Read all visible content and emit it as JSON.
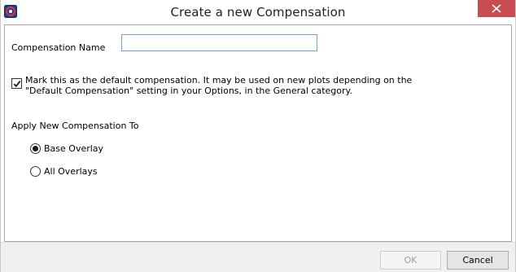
{
  "window": {
    "title": "Create a new Compensation",
    "app_icon": "flowjo-app-icon",
    "close_icon": "close-icon"
  },
  "form": {
    "name_label": "Compensation Name",
    "name_value": "",
    "default_checkbox": {
      "checked": true,
      "line1": "Mark this as the default compensation. It may be used on new plots depending on the",
      "line2": "\"Default Compensation\" setting in your Options, in the General category."
    },
    "apply_section_label": "Apply New Compensation To",
    "apply_options": [
      {
        "label": "Base Overlay",
        "selected": true
      },
      {
        "label": "All Overlays",
        "selected": false
      }
    ]
  },
  "footer": {
    "ok_label": "OK",
    "ok_enabled": false,
    "cancel_label": "Cancel"
  },
  "colors": {
    "close_button": "#c74b50",
    "input_border": "#7a9cd3"
  }
}
